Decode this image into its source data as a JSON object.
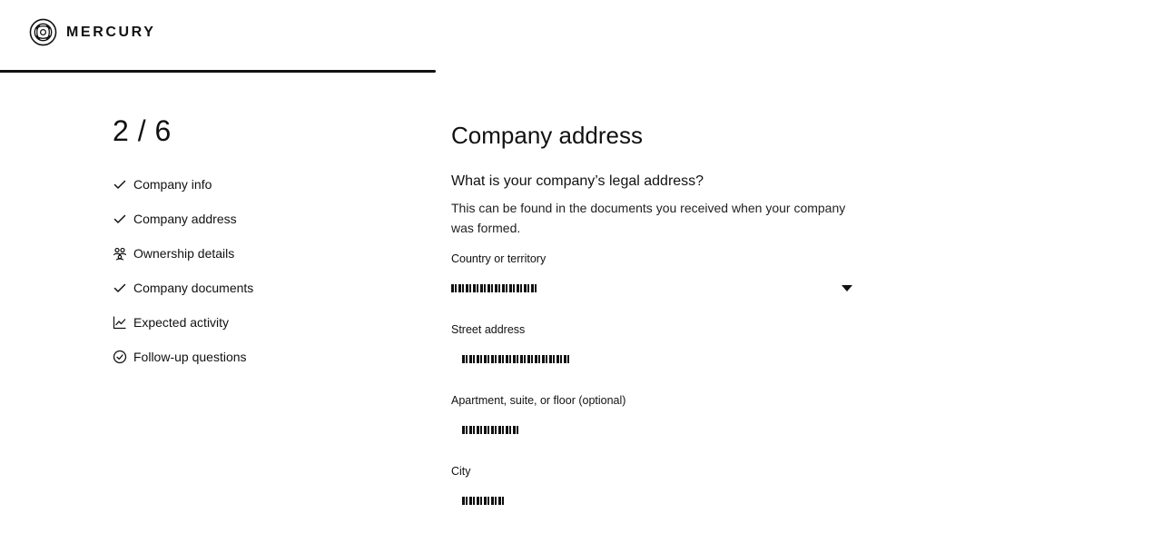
{
  "app": {
    "brand": "MERCURY",
    "logo_icon": "mercury-logo-icon"
  },
  "progress": {
    "fraction": 0.375
  },
  "steps": {
    "counter": "2 / 6",
    "items": [
      {
        "label": "Company info",
        "icon": "check-icon"
      },
      {
        "label": "Company address",
        "icon": "check-icon"
      },
      {
        "label": "Ownership details",
        "icon": "people-icon"
      },
      {
        "label": "Company documents",
        "icon": "check-icon"
      },
      {
        "label": "Expected activity",
        "icon": "line-chart-icon"
      },
      {
        "label": "Follow-up questions",
        "icon": "circle-check-icon"
      }
    ]
  },
  "form": {
    "title": "Company address",
    "question": "What is your company’s legal address?",
    "hint": "This can be found in the documents you received when your company was formed.",
    "fields": {
      "country": {
        "label": "Country or territory",
        "value": ""
      },
      "street": {
        "label": "Street address",
        "value": ""
      },
      "apartment": {
        "label": "Apartment, suite, or floor (optional)",
        "value": ""
      },
      "city": {
        "label": "City",
        "value": ""
      }
    }
  },
  "colors": {
    "text": "#111111",
    "background": "#ffffff",
    "progress": "#111111"
  }
}
